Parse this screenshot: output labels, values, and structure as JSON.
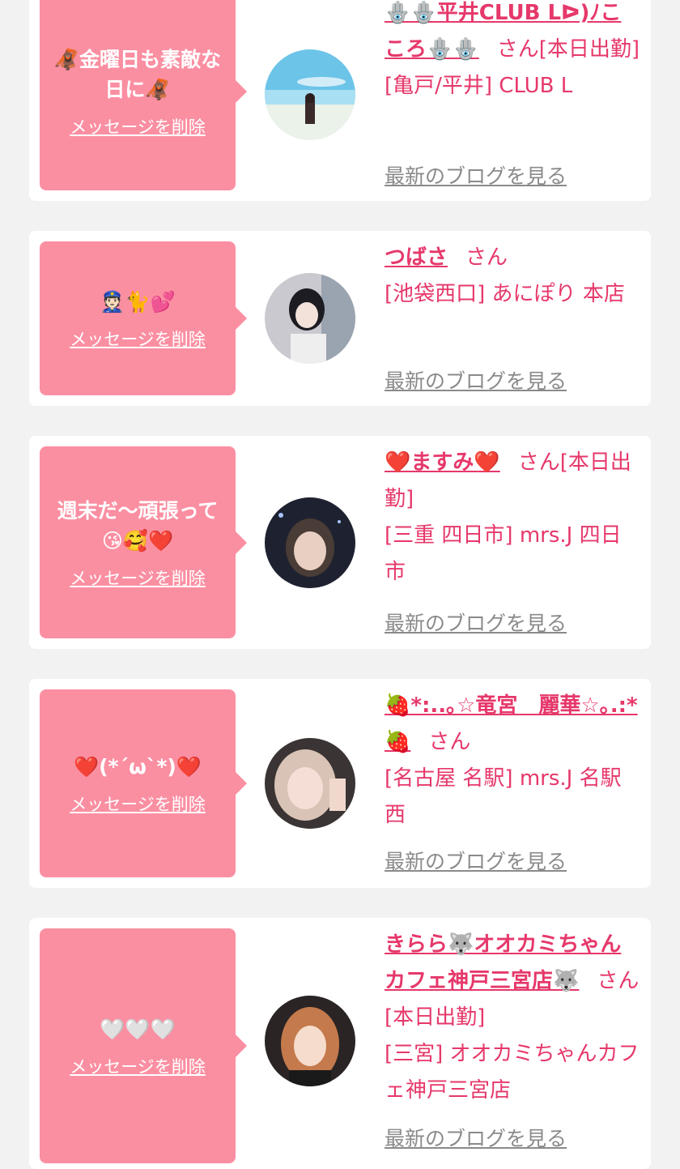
{
  "delete_label": "メッセージを削除",
  "blog_label": "最新のブログを見る",
  "entries": [
    {
      "message": "🦧金曜日も素敵な日に🦧",
      "name": "🪬🪬平井CLUB Lᐅ)ﾉこころ🪬🪬",
      "san": "さん",
      "status": "[本日出勤]",
      "shop": "[亀戸/平井] CLUB L"
    },
    {
      "message": "👮🏻🐈💕",
      "name": "つばさ",
      "san": "さん",
      "status": "",
      "shop": "[池袋西口] あにぽり 本店"
    },
    {
      "message": "週末だ〜頑張って😘🥰❤️",
      "name": "❤️ますみ❤️",
      "san": "さん",
      "status": "[本日出勤]",
      "shop": "[三重 四日市] mrs.J 四日市"
    },
    {
      "message": "❤️(*´ω`*)❤️",
      "name": "🍓*:..｡☆竜宮　麗華☆｡.:*🍓",
      "san": "さん",
      "status": "",
      "shop": "[名古屋 名駅] mrs.J 名駅西"
    },
    {
      "message": "🤍🤍🤍",
      "name": "きらら🐺オオカミちゃんカフェ神戸三宮店🐺",
      "san": "さん",
      "status": "[本日出勤]",
      "shop": "[三宮] オオカミちゃんカフェ神戸三宮店"
    }
  ]
}
